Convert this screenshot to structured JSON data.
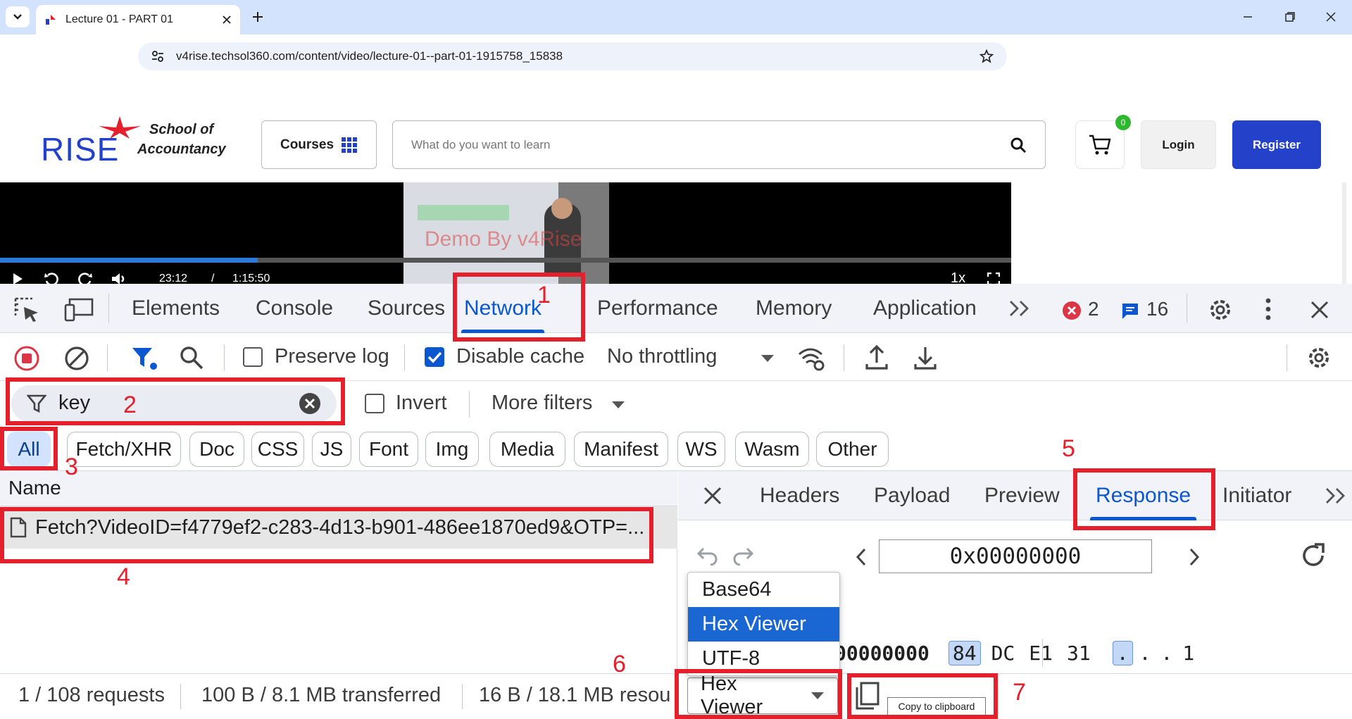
{
  "browser": {
    "tab_title": "Lecture 01 - PART 01",
    "url": "v4rise.techsol360.com/content/video/lecture-01--part-01-1915758_15838"
  },
  "site": {
    "logo_text": "RISE",
    "logo_tagline_1": "School of",
    "logo_tagline_2": "Accountancy",
    "courses_label": "Courses",
    "search_placeholder": "What do you want to learn",
    "cart_count": "0",
    "login_label": "Login",
    "register_label": "Register",
    "brand_color": "#2442c9"
  },
  "video": {
    "watermark": "Demo By v4Rise",
    "current_time": "23:12",
    "separator": "/",
    "duration": "1:15:50",
    "speed": "1x",
    "progress_fraction": 0.255
  },
  "devtools": {
    "tabs": [
      "Elements",
      "Console",
      "Sources",
      "Network",
      "Performance",
      "Memory",
      "Application"
    ],
    "active_tab": "Network",
    "error_count": "2",
    "message_count": "16",
    "toolbar": {
      "preserve_log": "Preserve log",
      "disable_cache": "Disable cache",
      "throttling": "No throttling"
    },
    "filter": {
      "value": "key",
      "invert": "Invert",
      "more_filters": "More filters"
    },
    "types": [
      "All",
      "Fetch/XHR",
      "Doc",
      "CSS",
      "JS",
      "Font",
      "Img",
      "Media",
      "Manifest",
      "WS",
      "Wasm",
      "Other"
    ],
    "name_header": "Name",
    "request_name": "Fetch?VideoID=f4779ef2-c283-4d13-b901-486ee1870ed9&OTP=...",
    "detail_tabs": [
      "Headers",
      "Payload",
      "Preview",
      "Response",
      "Initiator"
    ],
    "address": "0x00000000",
    "hex_row": {
      "offset": "00000000",
      "bytes": [
        "84",
        "DC",
        "E1",
        "31"
      ],
      "ascii": [
        ".",
        ".",
        ".",
        "1"
      ]
    },
    "dropdown_options": [
      "Base64",
      "Hex Viewer",
      "UTF-8"
    ],
    "selected_format": "Hex Viewer",
    "status": {
      "requests": "1 / 108 requests",
      "transferred": "100 B / 8.1 MB transferred",
      "resources": "16 B / 18.1 MB resou"
    },
    "copy_tooltip": "Copy to clipboard",
    "accent_color": "#0b57d0"
  },
  "annotations": [
    "1",
    "2",
    "3",
    "4",
    "5",
    "6",
    "7"
  ],
  "annotation_color": "#e3202c"
}
